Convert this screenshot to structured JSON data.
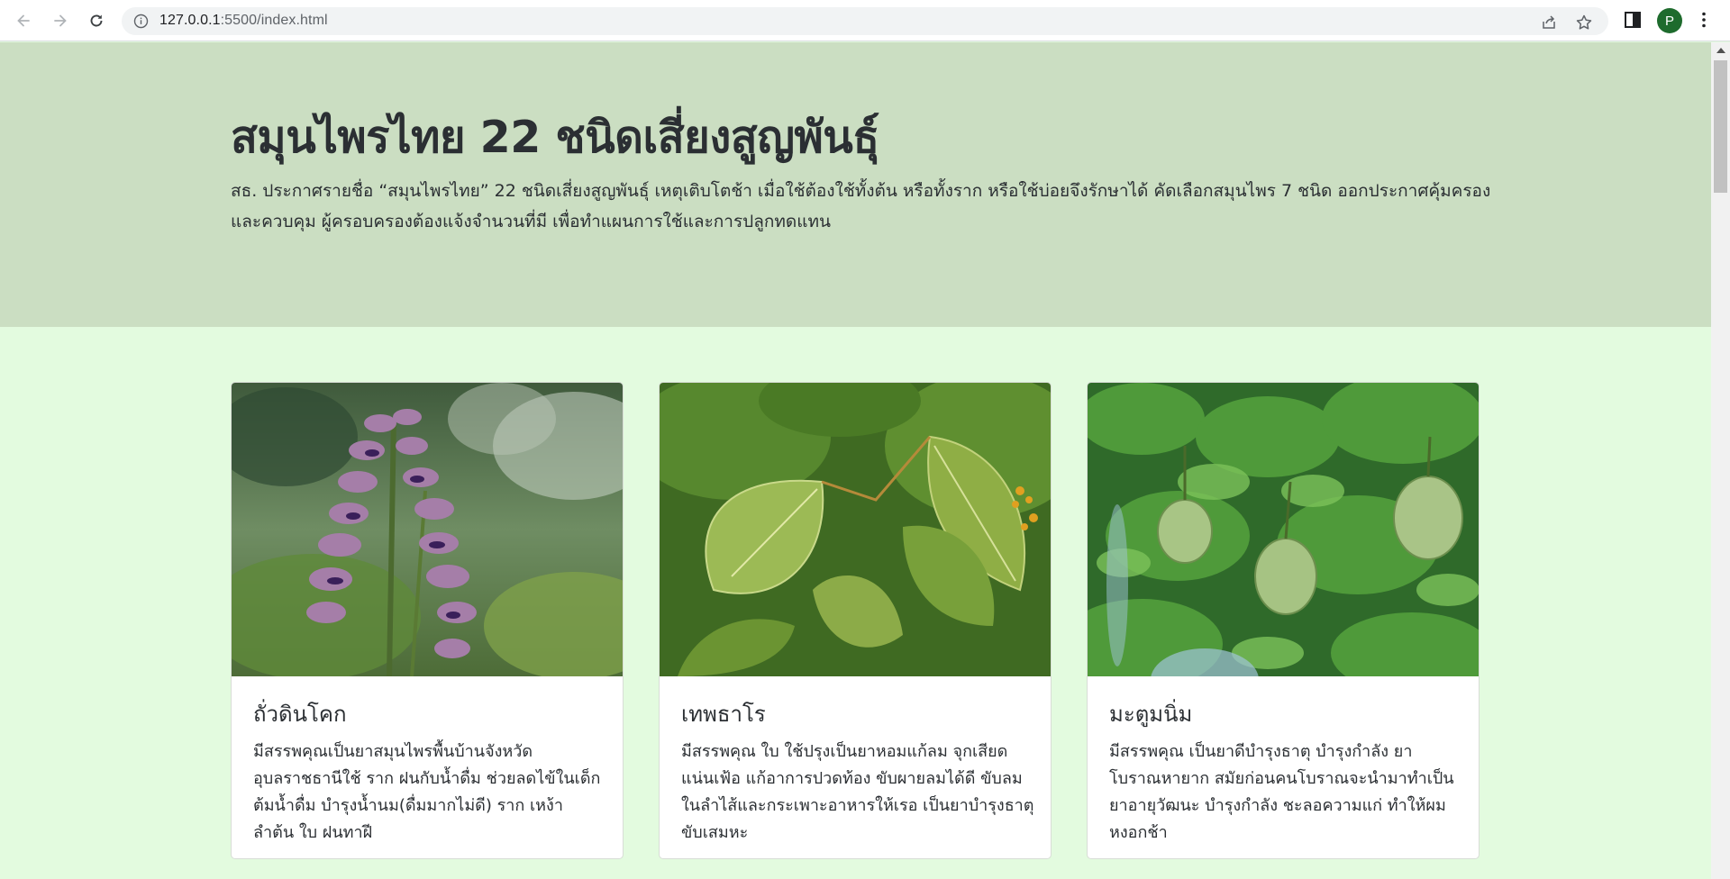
{
  "browser": {
    "url_host": "127.0.0.1",
    "url_path": ":5500/index.html",
    "profile_initial": "P",
    "icons": [
      "back-icon",
      "forward-icon",
      "reload-icon",
      "info-icon",
      "share-icon",
      "star-icon",
      "side-panel-icon",
      "menu-icon"
    ]
  },
  "hero": {
    "title": "สมุนไพรไทย 22 ชนิดเสี่ยงสูญพันธุ์",
    "description": "สธ. ประกาศรายชื่อ “สมุนไพรไทย” 22 ชนิดเสี่ยงสูญพันธุ์ เหตุเติบโตช้า เมื่อใช้ต้องใช้ทั้งต้น หรือทั้งราก หรือใช้บ่อยจึงรักษาได้ คัดเลือกสมุนไพร 7 ชนิด ออกประกาศคุ้มครองและควบคุม ผู้ครอบครองต้องแจ้งจำนวนที่มี เพื่อทำแผนการใช้และการปลูกทดแทน"
  },
  "cards": [
    {
      "title": "ถั่วดินโคก",
      "text": "มีสรรพคุณเป็นยาสมุนไพรพื้นบ้านจังหวัดอุบลราชธานีใช้ ราก ฝนกับน้ำดื่ม ช่วยลดไข้ในเด็ก ต้มน้ำดื่ม บำรุงน้ำนม(ดื่มมากไม่ดี) ราก เหง้า ลำต้น ใบ ฝนทาฝี",
      "image_icon": "purple-flower-image"
    },
    {
      "title": "เทพธาโร",
      "text": "มีสรรพคุณ ใบ ใช้ปรุงเป็นยาหอมแก้ลม จุกเสียดแน่นเฟ้อ แก้อาการปวดท้อง ขับผายลมได้ดี ขับลมในลำไส้และกระเพาะอาหารให้เรอ เป็นยาบำรุงธาตุ ขับเสมหะ",
      "image_icon": "green-leaves-image"
    },
    {
      "title": "มะตูมนิ่ม",
      "text": "มีสรรพคุณ เป็นยาดีบำรุงธาตุ บำรุงกำลัง ยาโบราณหายาก สมัยก่อนคนโบราณจะนำมาทำเป็น ยาอายุวัฒนะ บำรุงกำลัง ชะลอความแก่ ทำให้ผมหงอกช้า",
      "image_icon": "bael-fruit-image"
    }
  ],
  "colors": {
    "hero_bg": "#cbdec2",
    "page_bg": "#e3fbdf",
    "text": "#2b2f33",
    "avatar": "#1e6b2d"
  }
}
